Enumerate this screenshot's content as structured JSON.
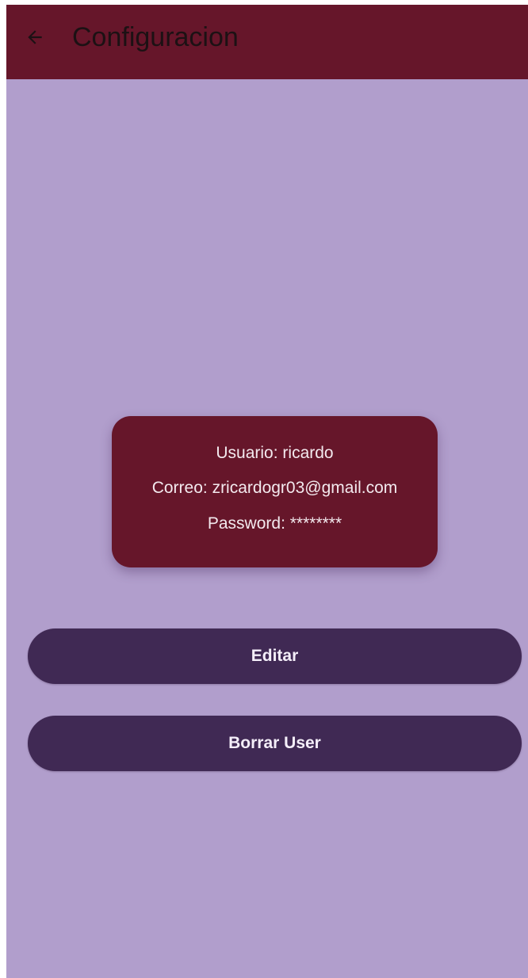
{
  "app_bar": {
    "title": "Configuracion",
    "back_icon": "arrow-left-icon"
  },
  "profile_card": {
    "user_label": "Usuario:",
    "user_value": "ricardo",
    "email_label": "Correo:",
    "email_value": "zricardogr03@gmail.com",
    "password_label": "Password:",
    "password_value": "********"
  },
  "actions": {
    "edit_label": "Editar",
    "delete_label": "Borrar User"
  },
  "colors": {
    "app_bar": "#66162a",
    "background": "#b19ecc",
    "card": "#66162a",
    "button": "#402954",
    "button_text": "#f4eef9"
  }
}
